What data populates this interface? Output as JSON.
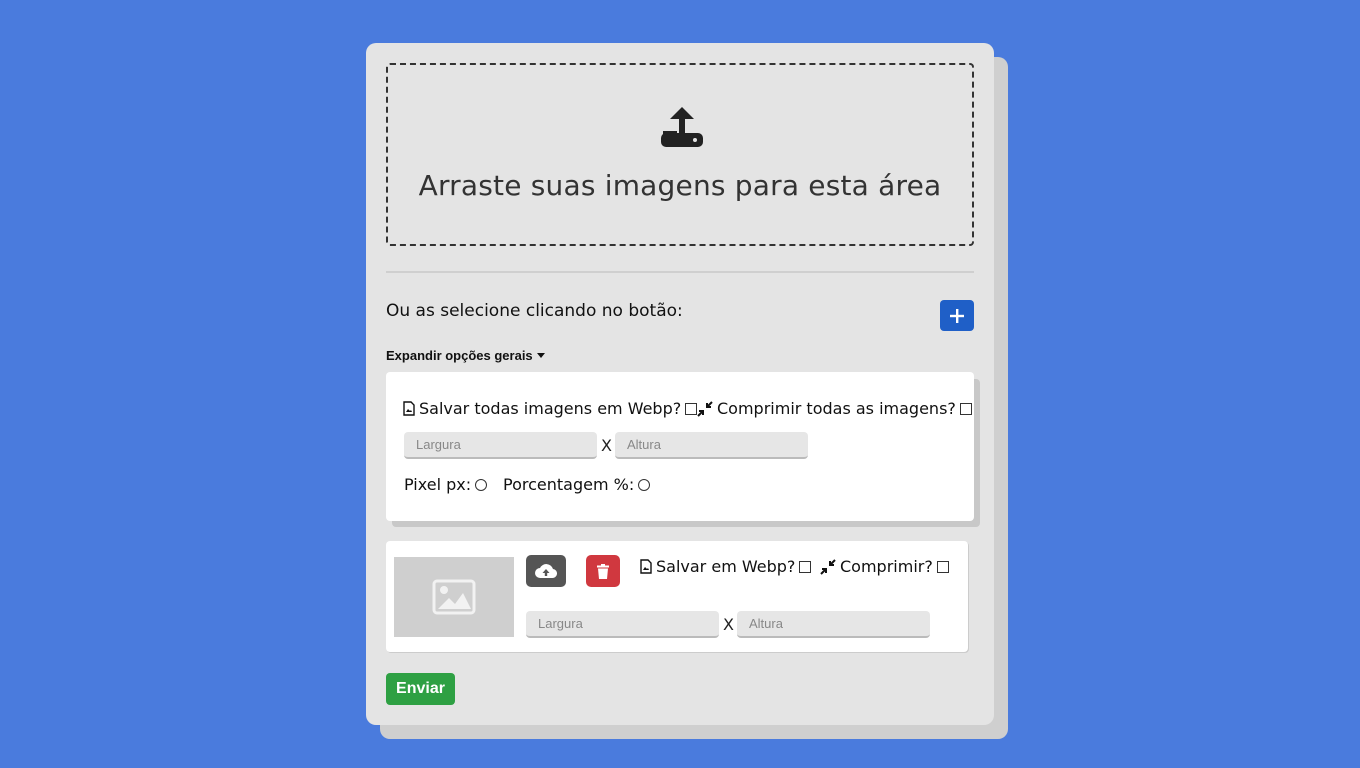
{
  "dropzone": {
    "icon": "upload-icon",
    "text": "Arraste suas imagens para esta área"
  },
  "select": {
    "label": "Ou as selecione clicando no botão:",
    "add_button_icon": "plus-icon"
  },
  "general_options": {
    "toggle_label": "Expandir opções gerais",
    "webp_label": "Salvar todas imagens em Webp?",
    "compress_label": "Comprimir todas as imagens?",
    "width_placeholder": "Largura",
    "height_placeholder": "Altura",
    "separator": "X",
    "pixel_label": "Pixel px:",
    "percent_label": "Porcentagem %:"
  },
  "image_item": {
    "thumbnail_icon": "image-placeholder-icon",
    "upload_button_icon": "cloud-upload-icon",
    "delete_button_icon": "trash-icon",
    "webp_label": "Salvar em Webp?",
    "compress_label": "Comprimir?",
    "width_placeholder": "Largura",
    "height_placeholder": "Altura",
    "separator": "X"
  },
  "submit": {
    "label": "Enviar"
  },
  "colors": {
    "background": "#4a7bdd",
    "card": "#e4e4e4",
    "add_button": "#1f5fc7",
    "upload_button": "#555555",
    "delete_button": "#d0383f",
    "submit_button": "#2ea043"
  }
}
